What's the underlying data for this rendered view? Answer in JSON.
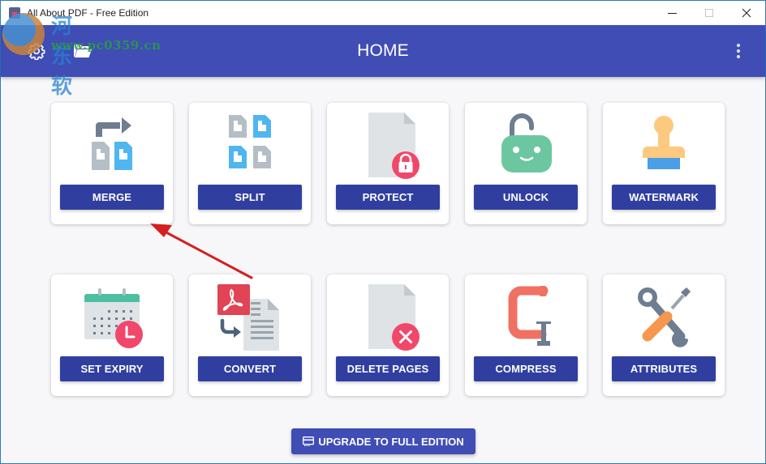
{
  "window": {
    "title": "All About PDF - Free Edition",
    "controls": [
      "minimize",
      "maximize",
      "close"
    ]
  },
  "watermark": {
    "site_name_cn": "河东软件园",
    "url": "www.pc0359.cn"
  },
  "appbar": {
    "title": "HOME",
    "left_icons": [
      "gear-icon",
      "folder-open-icon"
    ],
    "right_icon": "more-vert-icon"
  },
  "tools": [
    {
      "label": "MERGE",
      "icon": "merge-icon"
    },
    {
      "label": "SPLIT",
      "icon": "split-icon"
    },
    {
      "label": "PROTECT",
      "icon": "protect-icon"
    },
    {
      "label": "UNLOCK",
      "icon": "unlock-icon"
    },
    {
      "label": "WATERMARK",
      "icon": "stamp-icon"
    },
    {
      "label": "SET EXPIRY",
      "icon": "calendar-clock-icon"
    },
    {
      "label": "CONVERT",
      "icon": "convert-icon"
    },
    {
      "label": "DELETE PAGES",
      "icon": "delete-pages-icon"
    },
    {
      "label": "COMPRESS",
      "icon": "clamp-icon"
    },
    {
      "label": "ATTRIBUTES",
      "icon": "tools-icon"
    }
  ],
  "upgrade_button": {
    "label": "UPGRADE TO FULL EDITION",
    "icon": "credit-card-icon"
  },
  "colors": {
    "appbar": "#3f4db5",
    "button": "#303f9f",
    "background": "#f7f7f9",
    "annotation_arrow": "#d42020"
  }
}
